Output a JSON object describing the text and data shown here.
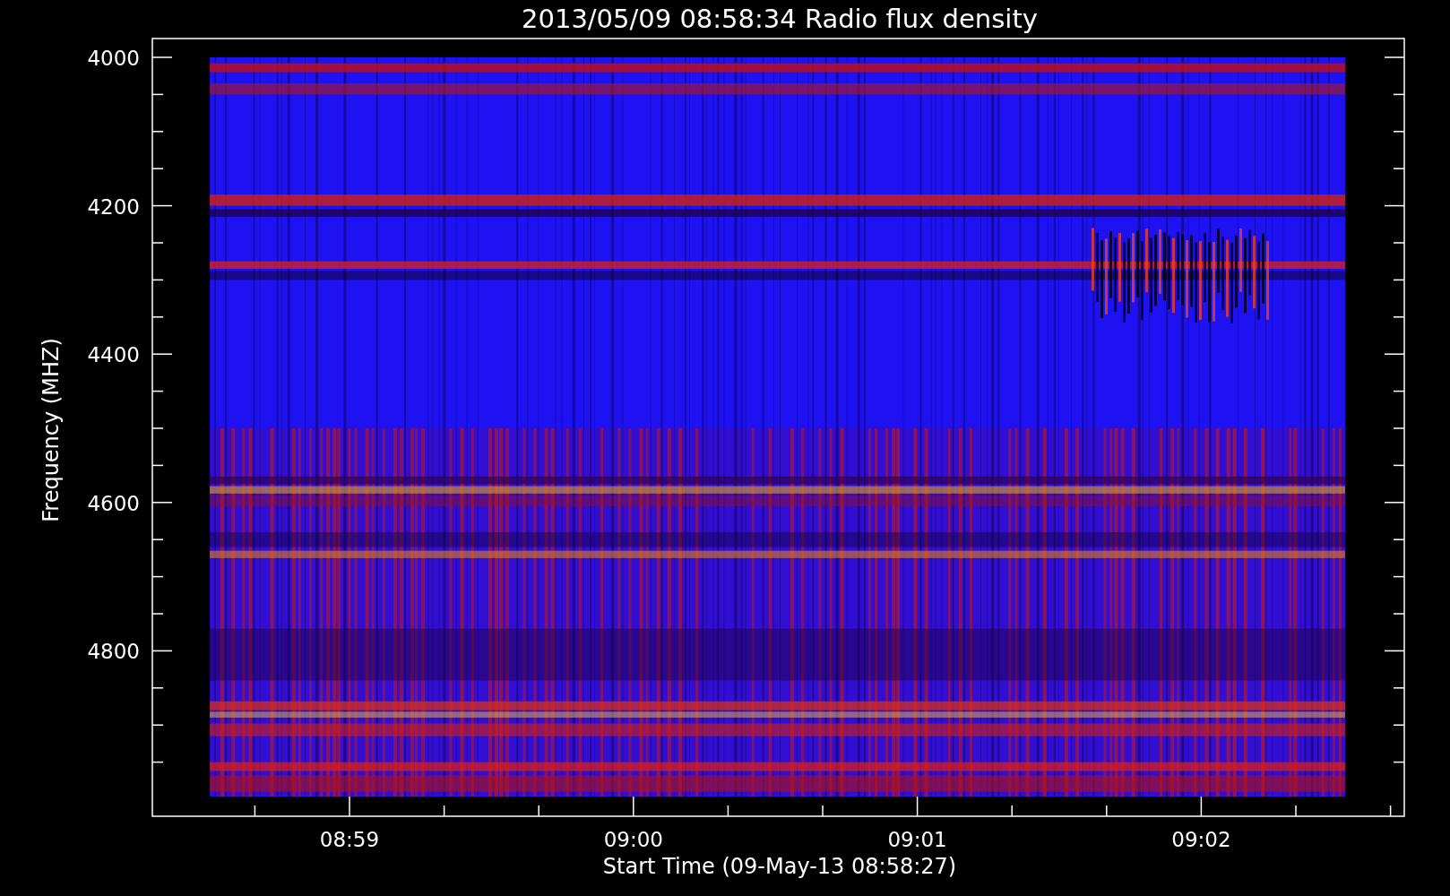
{
  "title": "2013/05/09 08:58:34 Radio flux density",
  "y_axis": {
    "label": "Frequency (MHZ)",
    "ticks": [
      "4000",
      "4200",
      "4400",
      "4600",
      "4800"
    ]
  },
  "x_axis": {
    "label": "Start Time (09-May-13 08:58:27)",
    "ticks": [
      "08:59",
      "09:00",
      "09:01",
      "09:02"
    ]
  }
}
